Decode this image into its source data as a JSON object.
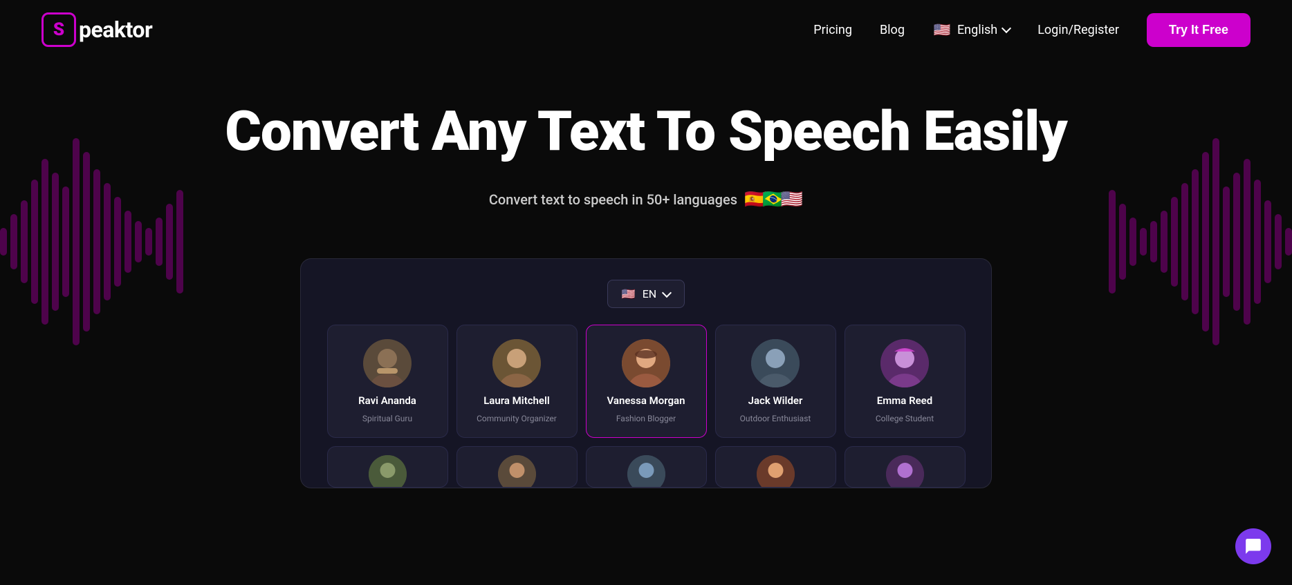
{
  "logo": {
    "icon_letter": "S",
    "text": "peaktor"
  },
  "nav": {
    "pricing": "Pricing",
    "blog": "Blog",
    "lang_label": "English",
    "login_register": "Login/Register",
    "cta_button": "Try It Free"
  },
  "hero": {
    "title": "Convert Any Text To Speech Easily",
    "subtitle": "Convert text to speech in 50+ languages",
    "flags": [
      "🇪🇸",
      "🇧🇷",
      "🇺🇸"
    ]
  },
  "app": {
    "lang_selector": {
      "flag": "🇺🇸",
      "code": "EN"
    },
    "voices": [
      {
        "name": "Ravi Ananda",
        "role": "Spiritual Guru",
        "emoji": "🧔"
      },
      {
        "name": "Laura Mitchell",
        "role": "Community Organizer",
        "emoji": "👩"
      },
      {
        "name": "Vanessa Morgan",
        "role": "Fashion Blogger",
        "emoji": "👩‍🦱"
      },
      {
        "name": "Jack Wilder",
        "role": "Outdoor Enthusiast",
        "emoji": "🧑"
      },
      {
        "name": "Emma Reed",
        "role": "College Student",
        "emoji": "👩‍🦰"
      }
    ],
    "voices_second_row": [
      {
        "emoji": "👨"
      },
      {
        "emoji": "👩"
      },
      {
        "emoji": "👦"
      }
    ]
  },
  "chat": {
    "icon": "💬"
  }
}
